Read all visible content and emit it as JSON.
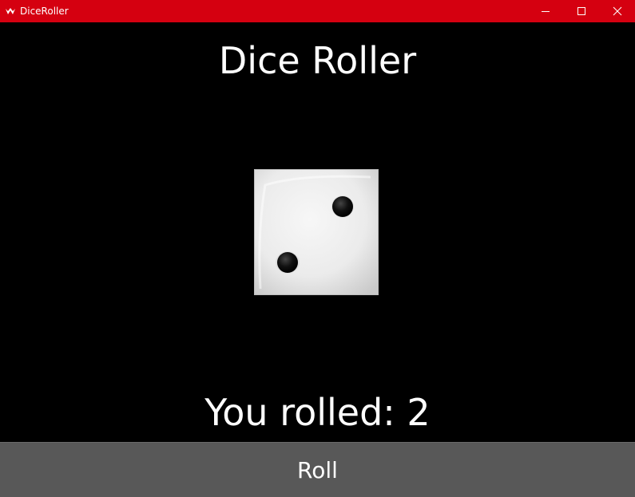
{
  "window": {
    "title": "DiceRoller",
    "titlebar_color": "#d50010",
    "controls": {
      "minimize_icon": "minimize-icon",
      "maximize_icon": "maximize-icon",
      "close_icon": "close-icon"
    }
  },
  "main": {
    "heading": "Dice Roller",
    "die": {
      "face_value": 2,
      "icon": "die-face-2"
    },
    "result_text": "You rolled: 2",
    "roll_button_label": "Roll",
    "roll_button_color": "#585858"
  }
}
